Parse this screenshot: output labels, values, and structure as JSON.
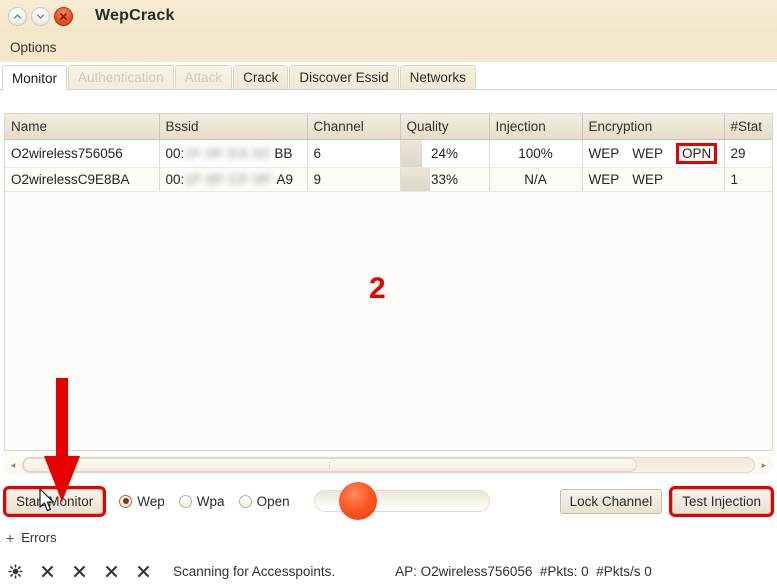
{
  "window": {
    "title": "WepCrack",
    "controls": [
      {
        "name": "minimize",
        "glyph": "⌃"
      },
      {
        "name": "maximize",
        "glyph": "⌄"
      },
      {
        "name": "close",
        "glyph": "✕"
      }
    ]
  },
  "menubar": {
    "items": [
      {
        "label": "Options"
      }
    ]
  },
  "tabs": [
    {
      "label": "Monitor",
      "state": "active"
    },
    {
      "label": "Authentication",
      "state": "disabled"
    },
    {
      "label": "Attack",
      "state": "disabled"
    },
    {
      "label": "Crack",
      "state": "normal"
    },
    {
      "label": "Discover Essid",
      "state": "normal"
    },
    {
      "label": "Networks",
      "state": "normal"
    }
  ],
  "table": {
    "columns": [
      "Name",
      "Bssid",
      "Channel",
      "Quality",
      "Injection",
      "Encryption",
      "#Stat"
    ],
    "rows": [
      {
        "name": "O2wireless756056",
        "bssid_prefix": "00:",
        "bssid_blurred": "1F:9F:E9:30:",
        "bssid_suffix": "BB",
        "channel": "6",
        "quality": "24%",
        "quality_pct": 24,
        "injection": "100%",
        "encryption": "WEP  WEP",
        "encryption_parts": [
          "WEP",
          "WEP"
        ],
        "open_badge": "OPN",
        "open_badge_highlight": true,
        "stat": "29",
        "selected": true
      },
      {
        "name": "O2wirelessC9E8BA",
        "bssid_prefix": "00:",
        "bssid_blurred": "1F:9F:CF:0F:",
        "bssid_suffix": "A9",
        "channel": "9",
        "quality": "33%",
        "quality_pct": 33,
        "injection": "N/A",
        "encryption": "WEP  WEP",
        "encryption_parts": [
          "WEP",
          "WEP"
        ],
        "open_badge": "",
        "open_badge_highlight": false,
        "stat": "1",
        "selected": false
      }
    ]
  },
  "scrollbar": {
    "left_arrow": "◂",
    "right_arrow": "▸",
    "grip": "⋮"
  },
  "controls": {
    "start_monitor": "Start Monitor",
    "start_monitor_highlight": true,
    "modes": [
      {
        "label": "Wep",
        "selected": true
      },
      {
        "label": "Wpa",
        "selected": false
      },
      {
        "label": "Open",
        "selected": false
      }
    ],
    "lock_channel": "Lock Channel",
    "test_injection": "Test Injection",
    "test_injection_highlight": true
  },
  "errors": {
    "expander": "+",
    "label": "Errors"
  },
  "status": {
    "icons": [
      "sun-icon",
      "cross-icon",
      "cross-icon",
      "cross-icon",
      "cross-icon"
    ],
    "message": "Scanning for Accesspoints.",
    "ap_label": "AP: O2wireless756056  #Pkts: 0  #Pkts/s 0"
  },
  "annotations": {
    "step_number": "2",
    "arrow_color": "#e60000",
    "highlight_color": "#e60000"
  }
}
